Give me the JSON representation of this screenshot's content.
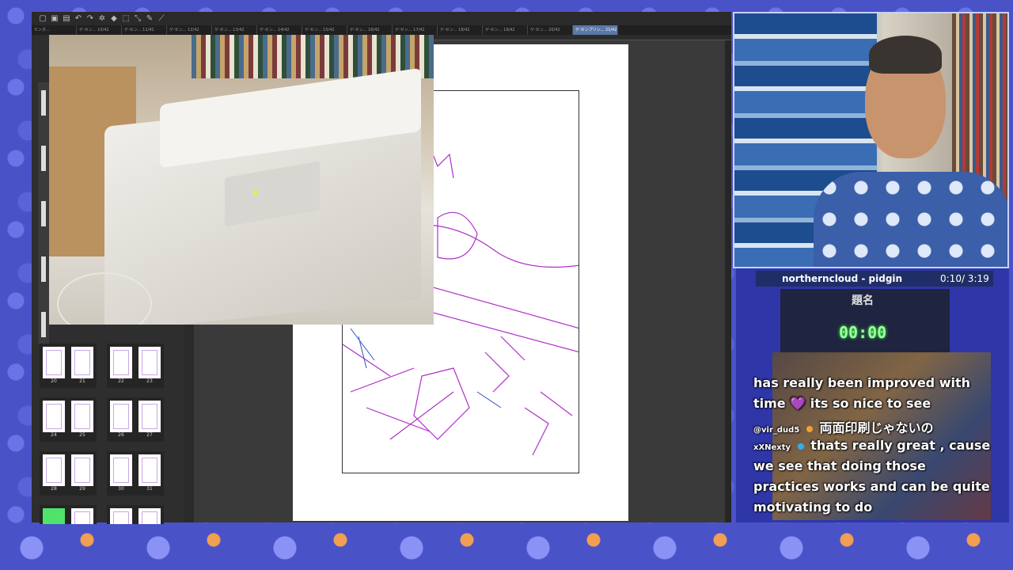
{
  "app": {
    "tabs": [
      "センタ... ",
      "ゲ-セン... 10/42",
      "ゲ-セン... 11/42",
      "ゲ-セン... 12/42",
      "ゲ-セン... 13/42",
      "ゲ-セン... 14/42",
      "ゲ-セン... 15/42",
      "ゲ-セン... 16/42",
      "ゲ-セン... 17/42",
      "ゲ-セン... 18/42",
      "ゲ-セン... 19/42",
      "ゲ-セン... 20/42",
      "ゲ-センプリン... 21/42"
    ],
    "page_numbers": [
      "20",
      "21",
      "22",
      "23",
      "24",
      "25",
      "26",
      "27",
      "28",
      "29",
      "30",
      "31"
    ],
    "accent_color": "#5a78a8"
  },
  "stream": {
    "now_playing": "northerncloud - pidgin",
    "time": "0:10/ 3:19",
    "timer_title": "題名",
    "timer_value": "00:00"
  },
  "chat": {
    "lines": [
      {
        "text": "has really been improved with"
      },
      {
        "text": "time 💜 its so nice to see"
      },
      {
        "user": "@vir_dud5",
        "text": "両面印刷じゃないの"
      },
      {
        "user": "xXNexty",
        "text": "thats really great , cause"
      },
      {
        "text": "we see that doing those"
      },
      {
        "text": "practices works and can be quite"
      },
      {
        "text": "motivating to do"
      }
    ]
  }
}
